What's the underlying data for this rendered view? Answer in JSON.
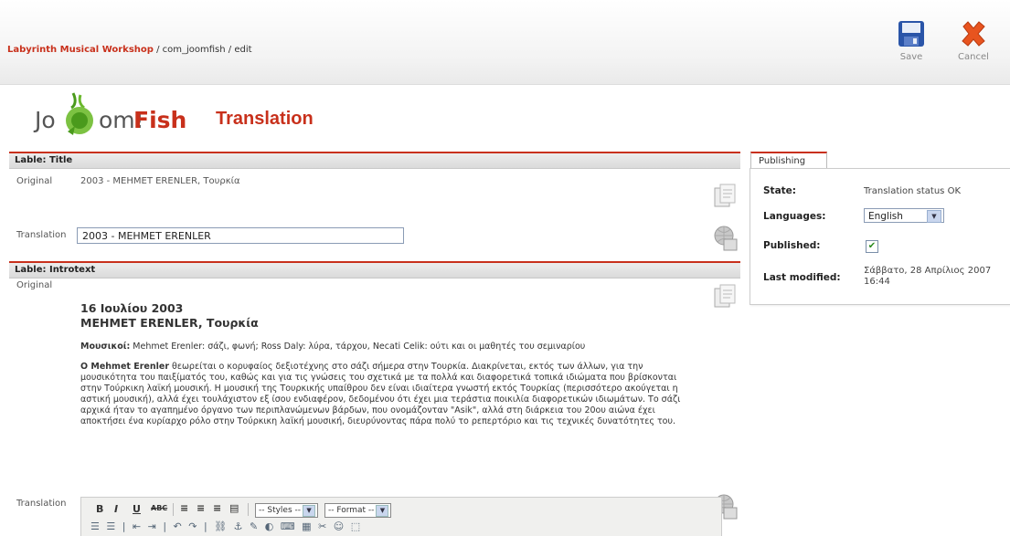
{
  "header": {
    "breadcrumb_site": "Labyrinth Musical Workshop",
    "breadcrumb_path": " / com_joomfish / edit",
    "save_label": "Save",
    "cancel_label": "Cancel"
  },
  "logo": {
    "part1": "Jo",
    "part2": "om!",
    "part3": "Fish"
  },
  "page_title": "Translation",
  "title_panel": {
    "heading": "Lable: Title",
    "original_label": "Original",
    "original_value": "2003 - MEHMET ERENLER, Τουρκία",
    "translation_label": "Translation",
    "translation_value": "2003 - MEHMET ERENLER"
  },
  "introtext_panel": {
    "heading": "Lable: Introtext",
    "original_label": "Original",
    "date_line": "16 Ιουλίου 2003",
    "name_line": "MEHMET ERENLER, Τουρκία",
    "musicians_label": "Μουσικοί:",
    "musicians_text": " Mehmet Erenler: σάζι, φωνή; Ross Daly: λύρα, τάρχου, Necati Celik: ούτι και οι μαθητές του σεμιναρίου",
    "para_name": "Ο Mehmet Erenler",
    "para_text": " θεωρείται ο κορυφαίος δεξιοτέχνης στο σάζι σήμερα στην Τουρκία. Διακρίνεται, εκτός των άλλων, για την μουσικότητα του παιξίματός του, καθώς και για τις γνώσεις του σχετικά με τα πολλά και διαφορετικά τοπικά ιδιώματα που βρίσκονται στην Τούρκικη λαϊκή μουσική. Η μουσική της Τουρκικής υπαίθρου δεν είναι ιδιαίτερα γνωστή εκτός Τουρκίας (περισσότερο ακούγεται η αστική μουσική), αλλά έχει τουλάχιστον εξ ίσου ενδιαφέρον, δεδομένου ότι έχει μια τεράστια ποικιλία διαφορετικών ιδιωμάτων. Το σάζι αρχικά ήταν το αγαπημένο όργανο των περιπλανώμενων βάρδων, που ονομάζονταν \"Asik\", αλλά στη διάρκεια του 20ου αιώνα έχει αποκτήσει ένα κυρίαρχο ρόλο στην Τούρκικη λαϊκή μουσική, διευρύνοντας πάρα πολύ το ρεπερτόριο και τις τεχνικές δυνατότητες του.",
    "translation_label": "Translation"
  },
  "editor": {
    "bold": "B",
    "italic": "I",
    "underline": "U",
    "strike": "ABC",
    "styles": "-- Styles --",
    "format": "-- Format --",
    "second_row": "☰ ☰ | ⇤ ⇥ | ↶ ↷ | ⛓ ⚓ ✎ ◐ ⌨ ▦ ✂ ☺ ⬚"
  },
  "publishing": {
    "tab_label": "Publishing",
    "state_label": "State:",
    "state_value": "Translation status OK",
    "languages_label": "Languages:",
    "language_value": "English",
    "published_label": "Published:",
    "published_checked": true,
    "modified_label": "Last modified:",
    "modified_value_1": "Σάββατο, 28 Απρίλιος 2007",
    "modified_value_2": "16:44"
  },
  "colors": {
    "accent": "#c8301b"
  }
}
